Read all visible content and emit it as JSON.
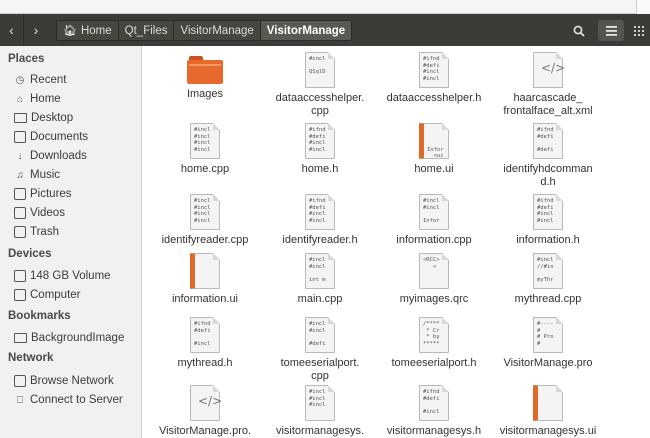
{
  "header": {
    "back_glyph": "‹",
    "forward_glyph": "›",
    "breadcrumbs": [
      "Home",
      "Qt_Files",
      "VisitorManage",
      "VisitorManage"
    ],
    "home_icon": "home-icon",
    "search_icon": "search-icon",
    "menu_icon": "hamburger-menu-icon",
    "grid_icon": "grid-view-icon"
  },
  "sidebar": {
    "places_title": "Places",
    "places": [
      "Recent",
      "Home",
      "Desktop",
      "Documents",
      "Downloads",
      "Music",
      "Pictures",
      "Videos",
      "Trash"
    ],
    "devices_title": "Devices",
    "devices": [
      "148 GB Volume",
      "Computer"
    ],
    "bookmarks_title": "Bookmarks",
    "bookmarks": [
      "BackgroundImage"
    ],
    "network_title": "Network",
    "network": [
      "Browse Network",
      "Connect to Server"
    ]
  },
  "files": [
    {
      "name": "Images",
      "kind": "folder"
    },
    {
      "name": "dataaccesshelper.\ncpp",
      "kind": "code",
      "preview": "#incl\n\nQSqlD"
    },
    {
      "name": "dataaccesshelper.h",
      "kind": "code",
      "preview": "#ifnd\n#defi\n#incl\n#incl"
    },
    {
      "name": "haarcascade_\nfrontalface_alt.xml",
      "kind": "xml",
      "preview": "</>"
    },
    {
      "name": "home.cpp",
      "kind": "code",
      "preview": "#incl\n#incl\n#incl\n#incl"
    },
    {
      "name": "home.h",
      "kind": "code",
      "preview": "#ifnd\n#defi\n#incl\n#incl"
    },
    {
      "name": "home.ui",
      "kind": "ui",
      "preview": "\n\n\nInfor\n  <ui"
    },
    {
      "name": "identifyhdcomman\nd.h",
      "kind": "code",
      "preview": "#ifnd\n#defi\n\n#defi"
    },
    {
      "name": "identifyreader.cpp",
      "kind": "code",
      "preview": "#incl\n#incl\n#incl\n#incl"
    },
    {
      "name": "identifyreader.h",
      "kind": "code",
      "preview": "#ifnd\n#defi\n#incl\n#incl"
    },
    {
      "name": "information.cpp",
      "kind": "code",
      "preview": "#incl\n#incl\n\nInfor"
    },
    {
      "name": "information.h",
      "kind": "code",
      "preview": "#ifnd\n#defi\n#incl\n#incl"
    },
    {
      "name": "information.ui",
      "kind": "ui",
      "preview": ""
    },
    {
      "name": "main.cpp",
      "kind": "code",
      "preview": "#incl\n#incl\n\nint m"
    },
    {
      "name": "myimages.qrc",
      "kind": "code",
      "preview": "<RCC>\n   <"
    },
    {
      "name": "mythread.cpp",
      "kind": "code",
      "preview": "#incl\n//#in\n\nmyThr"
    },
    {
      "name": "mythread.h",
      "kind": "code",
      "preview": "#ifnd\n#defi\n\n#incl"
    },
    {
      "name": "tomeeserialport.\ncpp",
      "kind": "code",
      "preview": "#incl\n#incl\n\n#defi"
    },
    {
      "name": "tomeeserialport.h",
      "kind": "code",
      "preview": "/****\n * Cr\n * by\n*****"
    },
    {
      "name": "VisitorManage.pro",
      "kind": "code",
      "preview": "#----\n#\n# Pro\n#"
    },
    {
      "name": "VisitorManage.pro.",
      "kind": "xml",
      "preview": "</>"
    },
    {
      "name": "visitormanagesys.",
      "kind": "code",
      "preview": "#incl\n#incl\n#incl"
    },
    {
      "name": "visitormanagesys.h",
      "kind": "code",
      "preview": "#ifnd\n#defi\n\n#incl"
    },
    {
      "name": "visitormanagesys.ui",
      "kind": "ui",
      "preview": ""
    }
  ]
}
